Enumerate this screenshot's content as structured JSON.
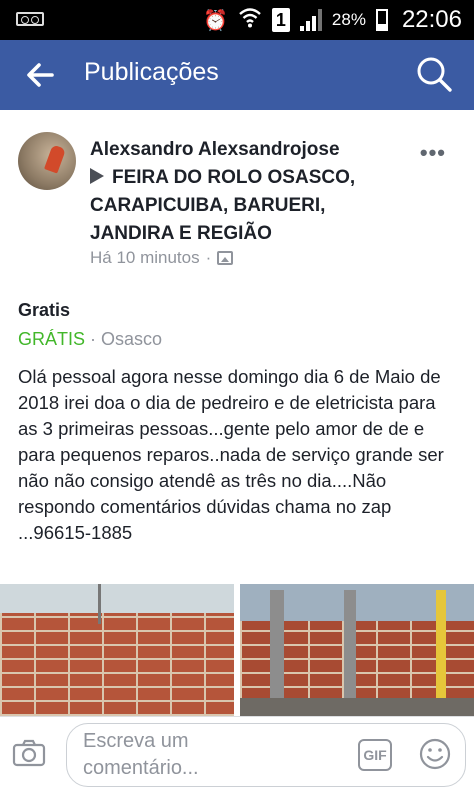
{
  "status_bar": {
    "battery_percent": "28%",
    "time": "22:06",
    "sim_label": "1"
  },
  "app_bar": {
    "title": "Publicações"
  },
  "post": {
    "author": "Alexsandro Alexsandrojose",
    "group": "FEIRA DO ROLO OSASCO, CARAPICUIBA, BARUERI, JANDIRA E REGIÃO",
    "time": "Há 10 minutos",
    "time_separator": "·",
    "more_label": "•••",
    "item_title": "Gratis",
    "price": "GRÁTIS",
    "location_separator": " · ",
    "location": "Osasco",
    "text": "Olá pessoal agora nesse domingo dia 6 de Maio de 2018 irei doa o dia de pedreiro e de eletricista para as 3 primeiras pessoas...gente pelo amor de de e para pequenos reparos..nada de serviço grande ser não não consigo atendê as três no dia....Não respondo comentários dúvidas chama no zap ...96615-1885"
  },
  "comment_bar": {
    "placeholder": "Escreva um comentário...",
    "gif_label": "GIF"
  },
  "colors": {
    "brand": "#3b5ba3",
    "price_green": "#42b72a",
    "meta_gray": "#90949c"
  }
}
